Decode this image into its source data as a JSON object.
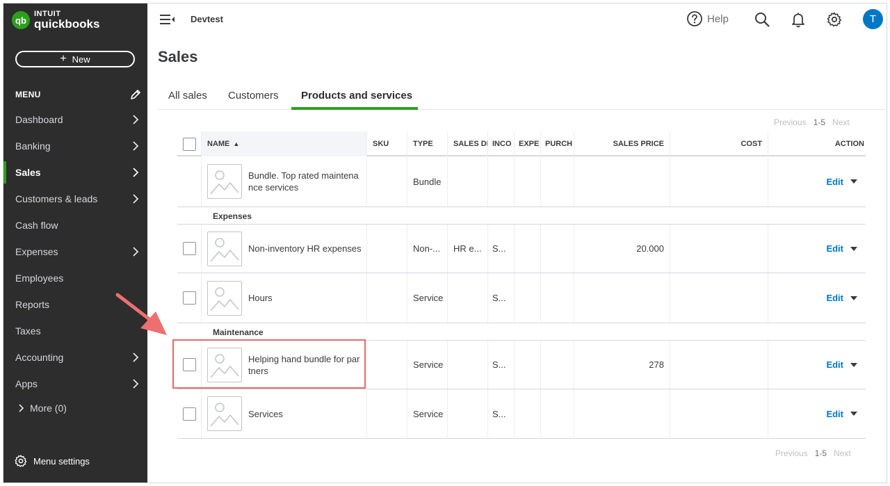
{
  "brand": {
    "intuit": "INTUIT",
    "product": "quickbooks",
    "logo_glyph": "qb"
  },
  "sidebar": {
    "new_label": "New",
    "menu_label": "MENU",
    "items": [
      {
        "label": "Dashboard",
        "chevron": true
      },
      {
        "label": "Banking",
        "chevron": true
      },
      {
        "label": "Sales",
        "chevron": true,
        "active": true
      },
      {
        "label": "Customers & leads",
        "chevron": true
      },
      {
        "label": "Cash flow",
        "chevron": false
      },
      {
        "label": "Expenses",
        "chevron": true
      },
      {
        "label": "Employees",
        "chevron": false
      },
      {
        "label": "Reports",
        "chevron": false
      },
      {
        "label": "Taxes",
        "chevron": false
      },
      {
        "label": "Accounting",
        "chevron": true
      },
      {
        "label": "Apps",
        "chevron": true
      }
    ],
    "more_label": "More (0)",
    "settings_label": "Menu settings"
  },
  "topbar": {
    "company": "Devtest",
    "help_label": "Help",
    "avatar_initial": "T"
  },
  "page": {
    "title": "Sales"
  },
  "tabs": [
    {
      "label": "All sales"
    },
    {
      "label": "Customers"
    },
    {
      "label": "Products and services",
      "active": true
    }
  ],
  "pager": {
    "previous": "Previous",
    "range": "1-5",
    "next": "Next"
  },
  "table": {
    "columns": {
      "name": "NAME",
      "sku": "SKU",
      "type": "TYPE",
      "sales_desc": "SALES DE",
      "income": "INCO",
      "expense": "EXPE",
      "purchase": "PURCH",
      "sales_price": "SALES PRICE",
      "cost": "COST",
      "action": "ACTION"
    },
    "sort_indicator": "▲",
    "edit_label": "Edit",
    "groups": [
      {
        "label": "Expenses"
      },
      {
        "label": "Maintenance"
      }
    ],
    "rows": [
      {
        "name": "Bundle. Top rated maintena nce services",
        "sku": "",
        "type": "Bundle",
        "sales_desc": "",
        "income": "",
        "expense": "",
        "purchase": "",
        "sales_price": "",
        "cost": ""
      },
      {
        "name": "Non-inventory HR expenses",
        "sku": "",
        "type": "Non-...",
        "sales_desc": "HR e...",
        "income": "S...",
        "expense": "",
        "purchase": "",
        "sales_price": "20.000",
        "cost": ""
      },
      {
        "name": "Hours",
        "sku": "",
        "type": "Service",
        "sales_desc": "",
        "income": "S...",
        "expense": "",
        "purchase": "",
        "sales_price": "",
        "cost": ""
      },
      {
        "name": "Helping hand bundle for par tners",
        "sku": "",
        "type": "Service",
        "sales_desc": "",
        "income": "S...",
        "expense": "",
        "purchase": "",
        "sales_price": "278",
        "cost": ""
      },
      {
        "name": "Services",
        "sku": "",
        "type": "Service",
        "sales_desc": "",
        "income": "S...",
        "expense": "",
        "purchase": "",
        "sales_price": "",
        "cost": ""
      }
    ]
  },
  "colors": {
    "brand_green": "#2ca01c",
    "link_blue": "#0077c5",
    "sidebar_bg": "#2d2d2d",
    "annotation_red": "#e36b6b"
  }
}
